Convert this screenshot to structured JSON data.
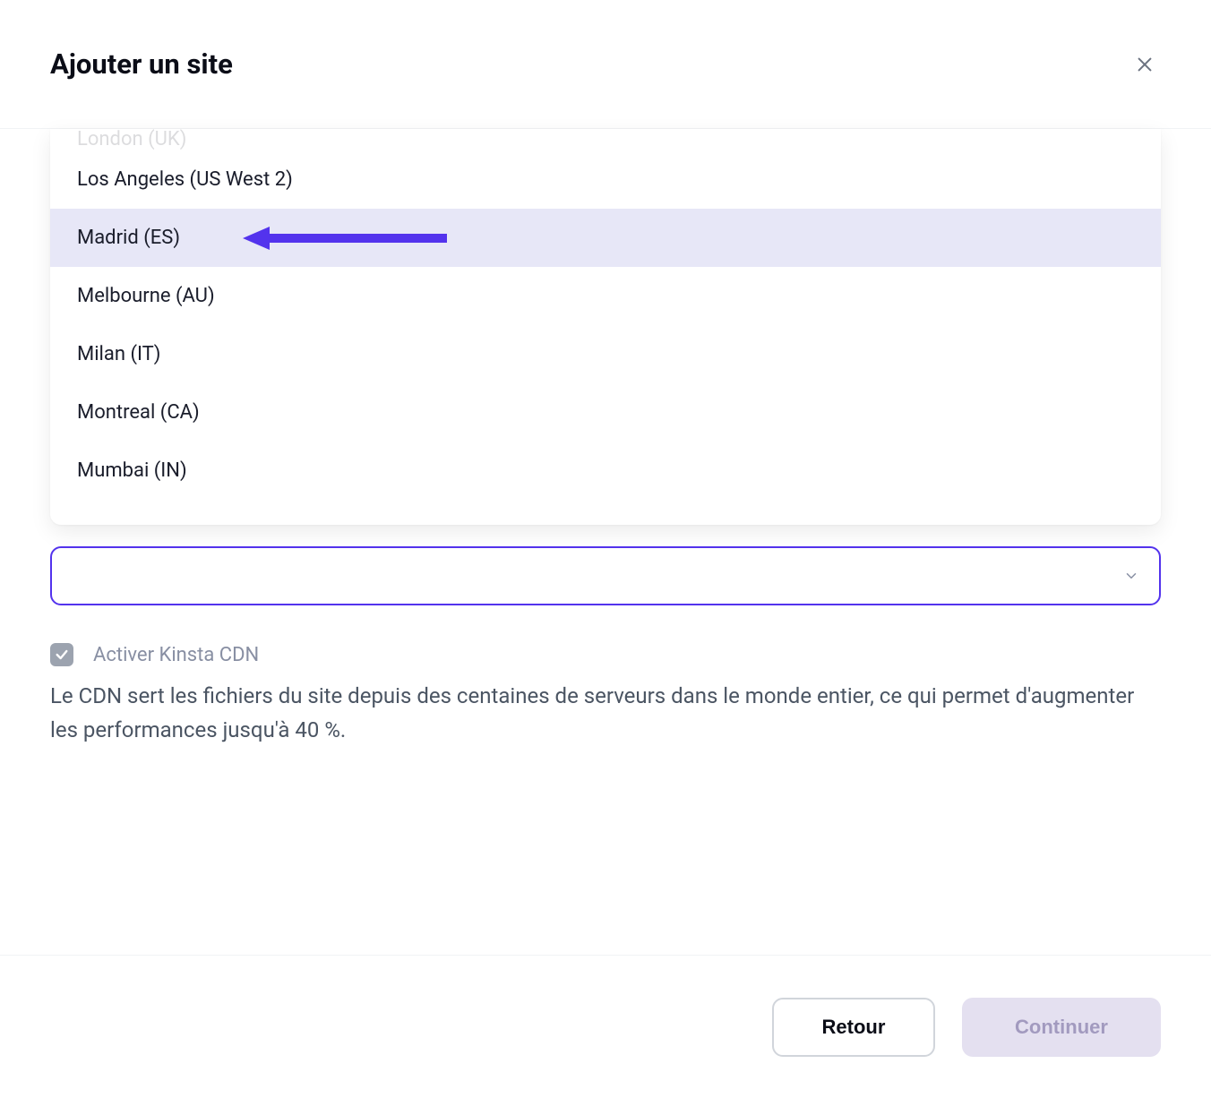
{
  "header": {
    "title": "Ajouter un site"
  },
  "dropdown": {
    "partial_top": "London (UK)",
    "options": [
      {
        "label": "Los Angeles (US West 2)",
        "highlighted": false
      },
      {
        "label": "Madrid (ES)",
        "highlighted": true
      },
      {
        "label": "Melbourne (AU)",
        "highlighted": false
      },
      {
        "label": "Milan (IT)",
        "highlighted": false
      },
      {
        "label": "Montreal (CA)",
        "highlighted": false
      },
      {
        "label": "Mumbai (IN)",
        "highlighted": false
      }
    ]
  },
  "cdn": {
    "checkbox_label": "Activer Kinsta CDN",
    "checked": true,
    "description": "Le CDN sert les fichiers du site depuis des centaines de serveurs dans le monde entier, ce qui permet d'augmenter les performances jusqu'à 40 %."
  },
  "footer": {
    "back_label": "Retour",
    "continue_label": "Continuer"
  },
  "annotation": {
    "arrow_color": "#5333ed"
  }
}
